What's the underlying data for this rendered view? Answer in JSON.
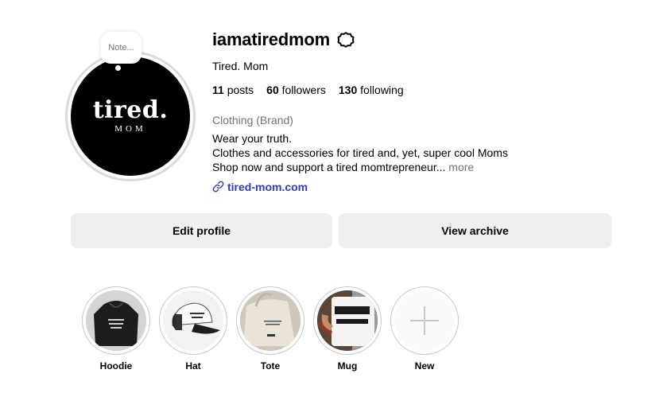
{
  "profile": {
    "username": "iamatiredmom",
    "full_name": "Tired. Mom",
    "note": "Note...",
    "avatar_text_main": "tired.",
    "avatar_text_sub": "MOM",
    "stats": {
      "posts_count": "11",
      "posts_label": "posts",
      "followers_count": "60",
      "followers_label": "followers",
      "following_count": "130",
      "following_label": "following"
    },
    "category": "Clothing (Brand)",
    "bio_line1": "Wear your truth.",
    "bio_line2": "Clothes and accessories for tired and, yet, super cool Moms",
    "bio_line3": "Shop now and support a tired momtrepreneur...",
    "more_label": "more",
    "website": "tired-mom.com",
    "link_color": "#2f3fb6"
  },
  "actions": {
    "edit_profile": "Edit profile",
    "view_archive": "View archive"
  },
  "highlights": [
    {
      "label": "Hoodie",
      "icon": "hoodie-thumbnail"
    },
    {
      "label": "Hat",
      "icon": "hat-thumbnail"
    },
    {
      "label": "Tote",
      "icon": "tote-thumbnail"
    },
    {
      "label": "Mug",
      "icon": "mug-thumbnail"
    },
    {
      "label": "New",
      "icon": "plus-icon"
    }
  ]
}
